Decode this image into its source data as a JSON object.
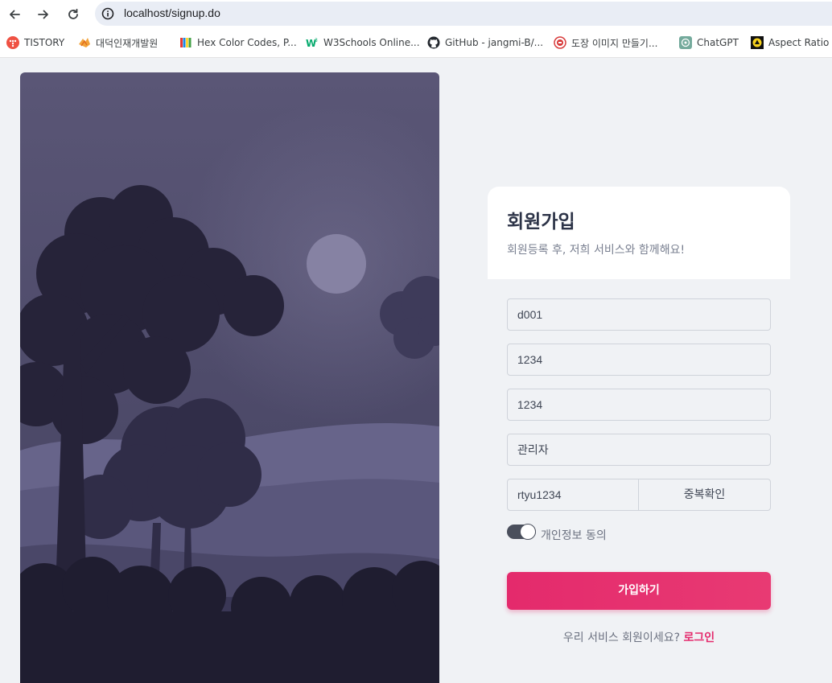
{
  "browser": {
    "url": "localhost/signup.do",
    "bookmarks": [
      {
        "label": "TISTORY",
        "icon": "tistory-icon"
      },
      {
        "label": "대덕인재개발원",
        "icon": "ddit-icon"
      },
      {
        "label": "Hex Color Codes, P...",
        "icon": "hex-color-icon"
      },
      {
        "label": "W3Schools Online...",
        "icon": "w3schools-icon"
      },
      {
        "label": "GitHub - jangmi-B/...",
        "icon": "github-icon"
      },
      {
        "label": "도장 이미지 만들기...",
        "icon": "stamp-icon"
      },
      {
        "label": "ChatGPT",
        "icon": "chatgpt-icon"
      },
      {
        "label": "Aspect Ratio C",
        "icon": "aspect-ratio-icon"
      }
    ]
  },
  "signup": {
    "title": "회원가입",
    "subtitle": "회원등록 후, 저희 서비스와 함께해요!",
    "fields": {
      "id": "d001",
      "password": "1234",
      "password_confirm": "1234",
      "name": "관리자",
      "nickname": "rtyu1234"
    },
    "duplicate_check_label": "중복확인",
    "agree_label": "개인정보 동의",
    "agree_checked": true,
    "submit_label": "가입하기",
    "footer_question": "우리 서비스 회원이세요?",
    "login_label": "로그인"
  },
  "colors": {
    "accent": "#e42a6c",
    "page_background": "#f0f2f5",
    "title_text": "#2c3347",
    "toggle_on": "#4a4f5c"
  }
}
